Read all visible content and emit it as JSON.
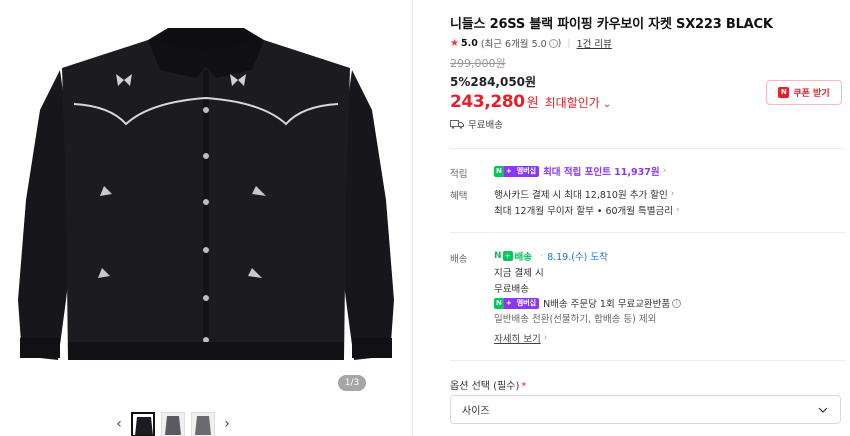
{
  "product": {
    "title": "니들스 26SS 블랙 파이핑 카우보이 자켓 SX223 BLACK",
    "rating": {
      "star_icon": "star-icon",
      "score": "5.0",
      "recent": "(최근 6개월 5.0",
      "info_suffix": ")",
      "review_link": "1건 리뷰"
    },
    "original_price": "299,000원",
    "discount_line": "5%284,050원",
    "sale_price": "243,280",
    "sale_won": "원",
    "sale_label": "최대할인가",
    "coupon_button": "쿠폰 받기",
    "free_shipping": "무료배송"
  },
  "gallery": {
    "page_indicator": "1/3",
    "prev_arrow": "‹",
    "next_arrow": "›",
    "thumb_count": 3,
    "active_thumb": 1
  },
  "benefits": {
    "points_label": "적립",
    "points_text": "최대 적립 포인트 11,937원",
    "badge_n": "N",
    "badge_plus": "+",
    "badge_member": "멤버십",
    "perks_label": "혜택",
    "card_discount": "행사카드 결제 시 최대 12,810원 추가 할인",
    "installment": "최대 12개월 무이자 할부 • 60개월 특별금리"
  },
  "delivery": {
    "label": "배송",
    "n_delivery": "배송",
    "date": "8.19.(수) 도착",
    "pay_now": "지금 결제 시",
    "free": "무료배송",
    "exchange": "N배송 주문당 1회 무료교환반품",
    "general_note": "일반배송 전환(선물하기, 합배송 등) 제외",
    "detail_link": "자세히 보기"
  },
  "options": {
    "label": "옵션 선택 (필수)",
    "required": "*",
    "size_select": "사이즈"
  },
  "colors": {
    "accent_red": "#e5202a",
    "npay_green": "#03c75a",
    "membership_purple": "#8a38f5"
  }
}
